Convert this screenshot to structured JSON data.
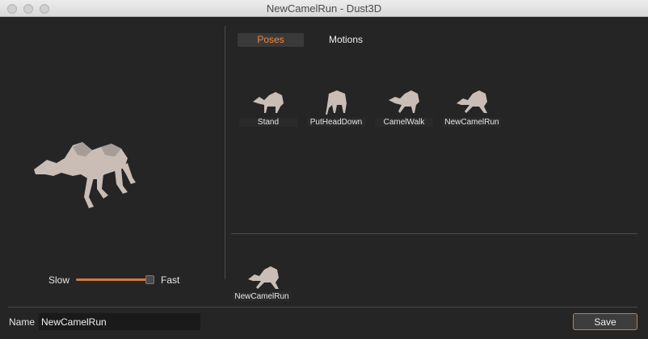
{
  "window": {
    "title": "NewCamelRun - Dust3D"
  },
  "preview": {
    "icon": "camel-model"
  },
  "speed": {
    "slow_label": "Slow",
    "fast_label": "Fast",
    "value_fraction": 0.9
  },
  "tabs": [
    {
      "label": "Poses",
      "active": true
    },
    {
      "label": "Motions",
      "active": false
    }
  ],
  "poses": [
    {
      "label": "Stand"
    },
    {
      "label": "PutHeadDown"
    },
    {
      "label": "CamelWalk"
    },
    {
      "label": "NewCamelRun"
    }
  ],
  "timeline": {
    "items": [
      {
        "label": "NewCamelRun"
      }
    ]
  },
  "name_field": {
    "label": "Name",
    "value": "NewCamelRun"
  },
  "save_button": {
    "label": "Save"
  },
  "colors": {
    "accent": "#f08a3c",
    "background": "#252525",
    "model": "#c9bdb6"
  }
}
